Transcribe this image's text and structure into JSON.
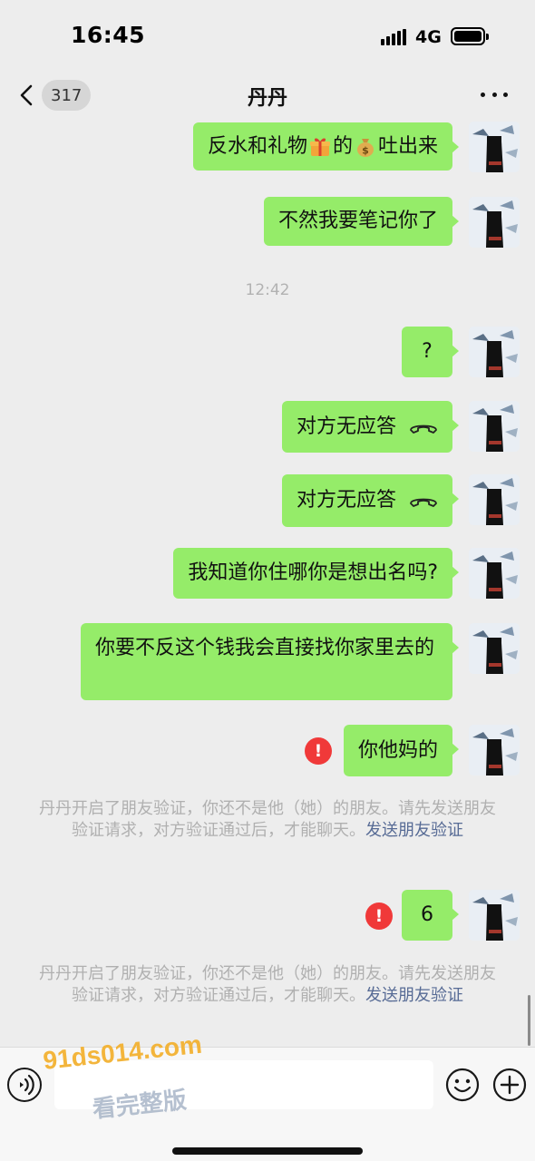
{
  "status_bar": {
    "time": "16:45",
    "network": "4G"
  },
  "nav": {
    "back_badge": "317",
    "title": "丹丹"
  },
  "messages": [
    {
      "text_before": "反水和礼物",
      "text_mid": "的",
      "text_after": "吐出来"
    },
    {
      "text": "不然我要笔记你了"
    },
    {
      "text": "?"
    },
    {
      "text": "对方无应答"
    },
    {
      "text": "对方无应答"
    },
    {
      "text": "我知道你住哪你是想出名吗?"
    },
    {
      "text": "你要不反这个钱我会直接找你家里去的"
    },
    {
      "text": "你他妈的"
    },
    {
      "text": "6"
    }
  ],
  "time_divider": "12:42",
  "system_notice": {
    "text": "丹丹开启了朋友验证，你还不是他（她）的朋友。请先发送朋友验证请求，对方验证通过后，才能聊天。",
    "link": "发送朋友验证"
  },
  "input_bar": {
    "value": ""
  },
  "watermark": {
    "url": "91ds014.com",
    "text": "看完整版"
  },
  "colors": {
    "bubble": "#95ec69",
    "error": "#f03939",
    "link": "#576b95"
  },
  "icons": [
    "chevron-left-icon",
    "more-icon",
    "gift-icon",
    "money-bag-icon",
    "call-end-icon",
    "error-icon",
    "voice-icon",
    "emoji-icon",
    "plus-icon"
  ]
}
